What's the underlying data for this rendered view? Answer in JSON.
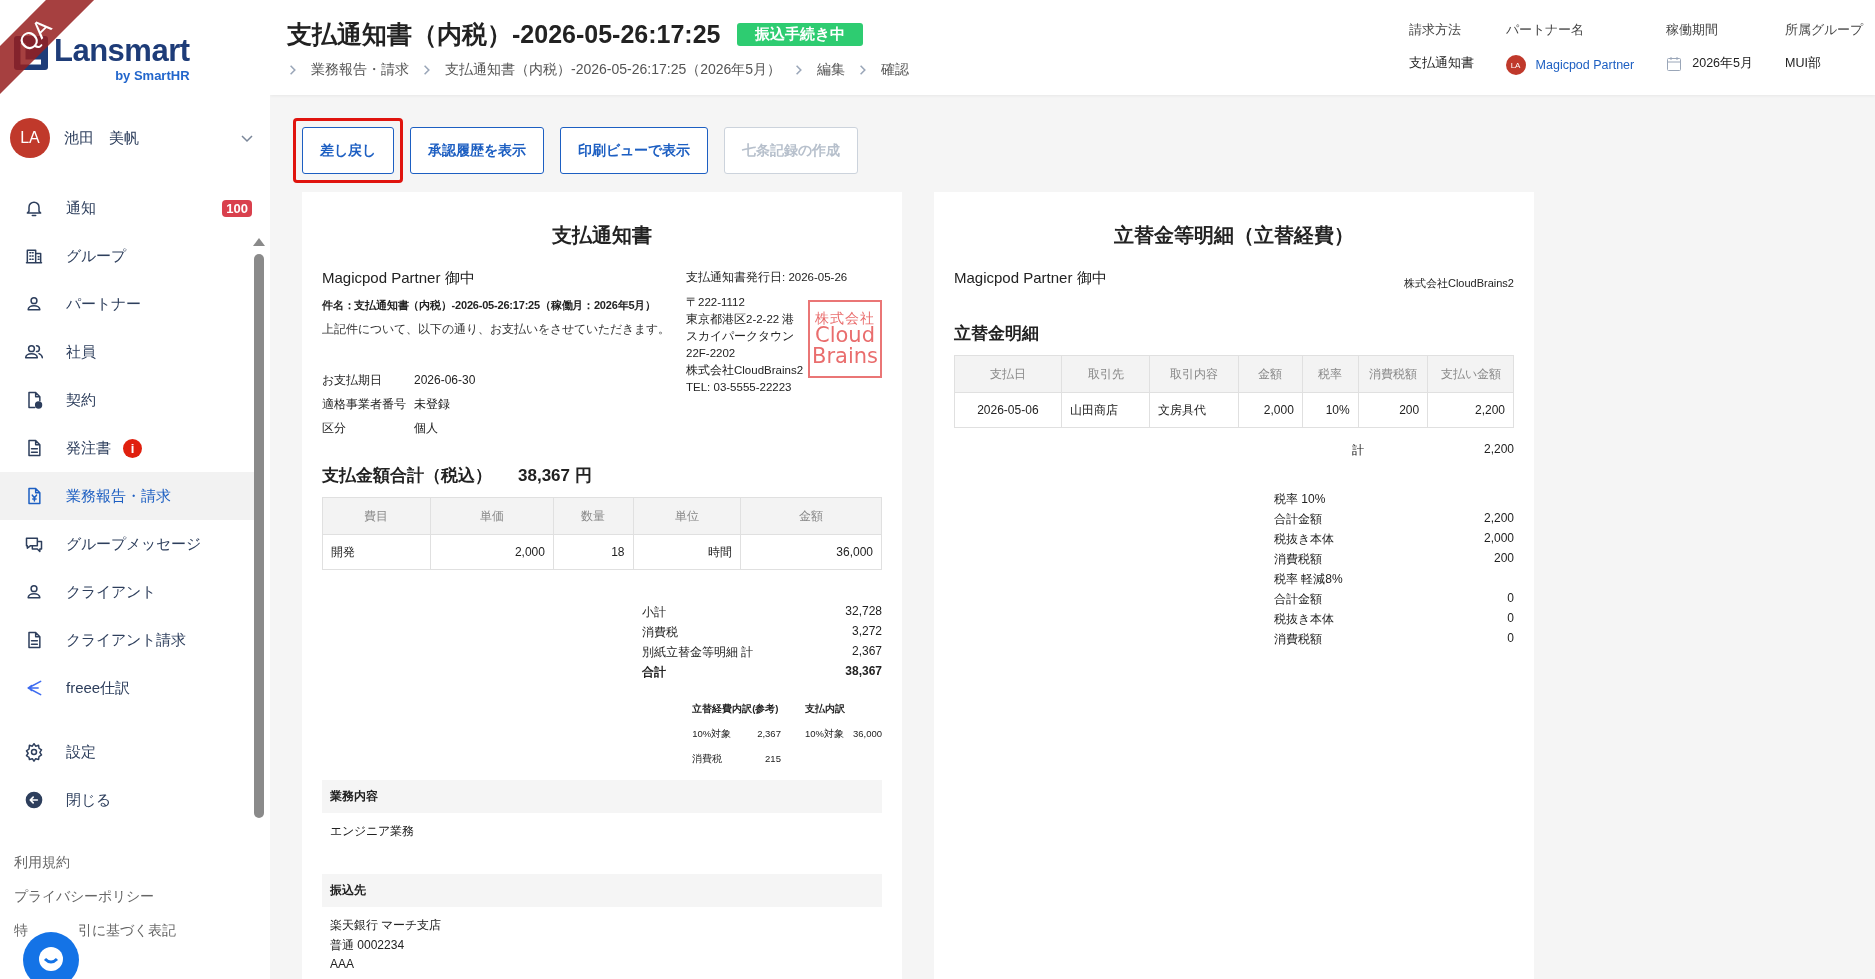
{
  "ribbon": {
    "label": "QA"
  },
  "logo": {
    "name": "Lansmart",
    "byline": "by SmartHR"
  },
  "user": {
    "initials": "LA",
    "name": "池田　美帆"
  },
  "nav": [
    {
      "label": "通知",
      "badge": "100",
      "selected": false
    },
    {
      "label": "グループ",
      "selected": false
    },
    {
      "label": "パートナー",
      "selected": false
    },
    {
      "label": "社員",
      "selected": false
    },
    {
      "label": "契約",
      "selected": false
    },
    {
      "label": "発注書",
      "alert": "i",
      "selected": false
    },
    {
      "label": "業務報告・請求",
      "selected": true
    },
    {
      "label": "グループメッセージ",
      "selected": false
    },
    {
      "label": "クライアント",
      "selected": false
    },
    {
      "label": "クライアント請求",
      "selected": false
    },
    {
      "label": "freee仕訳",
      "selected": false
    }
  ],
  "nav_bottom": [
    {
      "label": "設定",
      "selected": false
    },
    {
      "label": "閉じる",
      "selected": false
    }
  ],
  "footer_links": [
    {
      "parts": [
        "利用規約"
      ]
    },
    {
      "parts": [
        "プライバシーポリシー"
      ]
    },
    {
      "parts": [
        "特",
        "引に基づく表記"
      ]
    }
  ],
  "header": {
    "title": "支払通知書（内税）-2026-05-26:17:25",
    "status": "振込手続き中",
    "breadcrumbs": [
      "業務報告・請求",
      "支払通知書（内税）-2026-05-26:17:25（2026年5月）",
      "編集",
      "確認"
    ],
    "meta": [
      {
        "label": "請求方法",
        "value": "支払通知書",
        "kind": "text"
      },
      {
        "label": "パートナー名",
        "value": "Magicpod Partner",
        "kind": "partner",
        "avatar": "LA"
      },
      {
        "label": "稼働期間",
        "value": "2026年5月",
        "kind": "date"
      },
      {
        "label": "所属グループ",
        "value": "MUI部",
        "kind": "text"
      }
    ]
  },
  "actions": [
    {
      "label": "差し戻し",
      "disabled": false,
      "highlighted": true
    },
    {
      "label": "承認履歴を表示",
      "disabled": false,
      "highlighted": false
    },
    {
      "label": "印刷ビューで表示",
      "disabled": false,
      "highlighted": false
    },
    {
      "label": "七条記録の作成",
      "disabled": true,
      "highlighted": false
    }
  ],
  "notice": {
    "title": "支払通知書",
    "recipient": "Magicpod Partner 御中",
    "subject": "件名：支払通知書（内税）-2026-05-26:17:25（稼働月：2026年5月）",
    "intro": "上記件について、以下の通り、お支払いをさせていただきます。",
    "issue_date": "支払通知書発行日: 2026-05-26",
    "sender_lines": [
      "〒222-1112",
      "東京都港区2-2-22 港スカイパークタウン22F-2202",
      "株式会社CloudBrains2",
      "TEL: 03-5555-22223"
    ],
    "stamp": [
      "株式会社",
      "Cloud",
      "Brains"
    ],
    "details": [
      {
        "label": "お支払期日",
        "value": "2026-06-30"
      },
      {
        "label": "適格事業者番号",
        "value": "未登録"
      },
      {
        "label": "区分",
        "value": "個人"
      }
    ],
    "total_label": "支払金額合計（税込）",
    "total": "38,367 円",
    "columns": [
      "費目",
      "単価",
      "数量",
      "単位",
      "金額"
    ],
    "rows": [
      [
        "開発",
        "2,000",
        "18",
        "時間",
        "36,000"
      ]
    ],
    "summary": [
      {
        "label": "小計",
        "value": "32,728",
        "bold": false
      },
      {
        "label": "消費税",
        "value": "3,272",
        "bold": false
      },
      {
        "label": "別紙立替金等明細 計",
        "value": "2,367",
        "bold": false
      },
      {
        "label": "合計",
        "value": "38,367",
        "bold": true
      }
    ],
    "breakdown": {
      "expense_title": "立替経費内訳(参考)",
      "expense": [
        {
          "label": "10%対象",
          "value": "2,367"
        },
        {
          "label": "消費税",
          "value": "215"
        }
      ],
      "payment_title": "支払内訳",
      "payment": [
        {
          "label": "10%対象",
          "value": "36,000"
        }
      ]
    },
    "sections": [
      {
        "heading": "業務内容",
        "lines": [
          "エンジニア業務"
        ]
      },
      {
        "heading": "振込先",
        "lines": [
          "楽天銀行 マーチ支店",
          "普通 0002234",
          "AAA"
        ]
      }
    ]
  },
  "expense": {
    "title": "立替金等明細（立替経費）",
    "recipient": "Magicpod Partner 御中",
    "company": "株式会社CloudBrains2",
    "subtitle": "立替金明細",
    "columns": [
      "支払日",
      "取引先",
      "取引内容",
      "金額",
      "税率",
      "消費税額",
      "支払い金額"
    ],
    "rows": [
      [
        "2026-05-06",
        "山田商店",
        "文房具代",
        "2,000",
        "10%",
        "200",
        "2,200"
      ]
    ],
    "total_label": "計",
    "total": "2,200",
    "tax_groups": [
      {
        "heading": "税率 10%",
        "items": [
          {
            "label": "合計金額",
            "value": "2,200"
          },
          {
            "label": "税抜き本体",
            "value": "2,000"
          },
          {
            "label": "消費税額",
            "value": "200"
          }
        ]
      },
      {
        "heading": "税率 軽減8%",
        "items": [
          {
            "label": "合計金額",
            "value": "0"
          },
          {
            "label": "税抜き本体",
            "value": "0"
          },
          {
            "label": "消費税額",
            "value": "0"
          }
        ]
      }
    ]
  }
}
